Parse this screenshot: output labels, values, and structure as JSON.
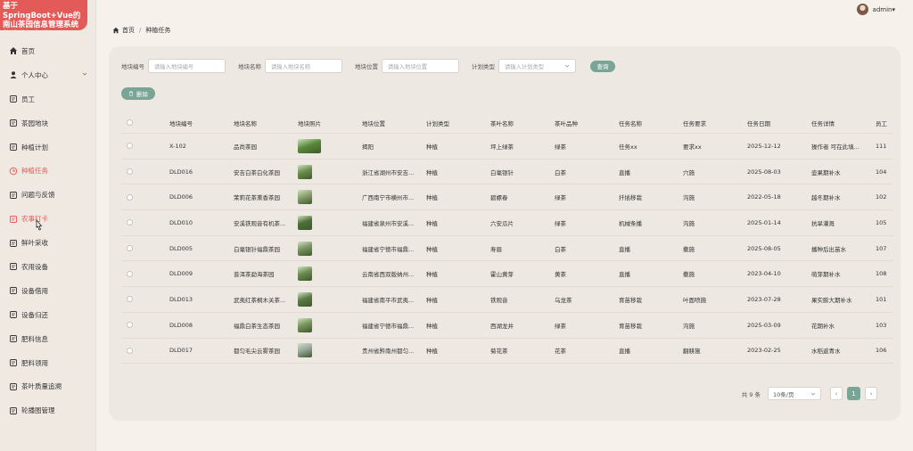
{
  "brand": {
    "title": "基于SpringBoot+Vue的南山茶园信息管理系统的设计与实现"
  },
  "sidebar": {
    "items": [
      {
        "label": "首页",
        "icon": "home-icon"
      },
      {
        "label": "个人中心",
        "icon": "user-icon"
      },
      {
        "label": "员工",
        "icon": "staff-icon"
      },
      {
        "label": "茶园地块",
        "icon": "plot-icon"
      },
      {
        "label": "种植计划",
        "icon": "plan-icon"
      },
      {
        "label": "种植任务",
        "icon": "clock-icon"
      },
      {
        "label": "问题与反馈",
        "icon": "feedback-icon"
      },
      {
        "label": "农事打卡",
        "icon": "checkin-icon"
      },
      {
        "label": "鲜叶采收",
        "icon": "harvest-icon"
      },
      {
        "label": "农用设备",
        "icon": "equipment-icon"
      },
      {
        "label": "设备借用",
        "icon": "borrow-icon"
      },
      {
        "label": "设备归还",
        "icon": "return-icon"
      },
      {
        "label": "肥料信息",
        "icon": "fertilizer-icon"
      },
      {
        "label": "肥料领用",
        "icon": "fertilizer-use-icon"
      },
      {
        "label": "茶叶质量追溯",
        "icon": "quality-icon"
      },
      {
        "label": "轮播图管理",
        "icon": "carousel-icon"
      }
    ]
  },
  "header": {
    "username": "admin",
    "user_caret": "▾"
  },
  "breadcrumb": {
    "home": "首页",
    "separator": "/",
    "current": "种植任务"
  },
  "search": {
    "plot_code_label": "地块编号",
    "plot_code_placeholder": "请输入地块编号",
    "plot_name_label": "地块名称",
    "plot_name_placeholder": "请输入地块名称",
    "plot_location_label": "地块位置",
    "plot_location_placeholder": "请输入地块位置",
    "plan_type_label": "计划类型",
    "plan_type_placeholder": "请输入计划类型",
    "query_button": "查询"
  },
  "toolbar": {
    "delete_button": "删除"
  },
  "table": {
    "columns": [
      "地块编号",
      "地块名称",
      "地块照片",
      "地块位置",
      "计划类型",
      "茶叶名称",
      "茶叶品种",
      "任务名称",
      "任务要求",
      "任务日期",
      "任务详情",
      "员工"
    ],
    "rows": [
      {
        "code": "X-102",
        "name": "品尚茶园",
        "location": "揭阳",
        "plan_type": "种植",
        "tea_name": "坪上绿茶",
        "variety": "绿茶",
        "task": "任务xx",
        "req": "要求xx",
        "date": "2025-12-12",
        "detail": "操作者 可在此填...",
        "staff": "111",
        "thumb_color": "#5a8a3c",
        "thumb_wide": true
      },
      {
        "code": "DLD016",
        "name": "安吉白茶白化茶园",
        "location": "浙江省湖州市安吉...",
        "plan_type": "种植",
        "tea_name": "白毫银针",
        "variety": "白茶",
        "task": "直播",
        "req": "穴施",
        "date": "2025-08-03",
        "detail": "壶果期补水",
        "staff": "104",
        "thumb_color": "#6b8e4e",
        "thumb_wide": false
      },
      {
        "code": "DLD006",
        "name": "茉莉花茶熏香茶园",
        "location": "广西南宁市横州市...",
        "plan_type": "种植",
        "tea_name": "碧螺春",
        "variety": "绿茶",
        "task": "扦插移栽",
        "req": "沟施",
        "date": "2022-05-18",
        "detail": "越冬期补水",
        "staff": "102",
        "thumb_color": "#8aa070",
        "thumb_wide": false
      },
      {
        "code": "DLD010",
        "name": "安溪铁观音有机茶...",
        "location": "福建省泉州市安溪...",
        "plan_type": "种植",
        "tea_name": "六安瓜片",
        "variety": "绿茶",
        "task": "机械条播",
        "req": "沟施",
        "date": "2025-01-14",
        "detail": "抗旱灌溉",
        "staff": "105",
        "thumb_color": "#4f6e3a",
        "thumb_wide": false
      },
      {
        "code": "DLD005",
        "name": "白毫银针福鼎茶园",
        "location": "福建省宁德市福鼎...",
        "plan_type": "种植",
        "tea_name": "寿眉",
        "variety": "白茶",
        "task": "直播",
        "req": "撒施",
        "date": "2025-08-05",
        "detail": "播种后出苗水",
        "staff": "107",
        "thumb_color": "#7c9466",
        "thumb_wide": false
      },
      {
        "code": "DLD009",
        "name": "普洱茶勐海茶园",
        "location": "云南省西双版纳州...",
        "plan_type": "种植",
        "tea_name": "霍山黄芽",
        "variety": "黄茶",
        "task": "直播",
        "req": "撒施",
        "date": "2023-04-10",
        "detail": "萌芽期补水",
        "staff": "108",
        "thumb_color": "#6d8b52",
        "thumb_wide": false
      },
      {
        "code": "DLD013",
        "name": "武夷红茶桐木关茶...",
        "location": "福建省南平市武夷...",
        "plan_type": "种植",
        "tea_name": "铁观音",
        "variety": "乌龙茶",
        "task": "育苗移栽",
        "req": "叶面喷施",
        "date": "2023-07-28",
        "detail": "果实膨大期补水",
        "staff": "101",
        "thumb_color": "#5c7a45",
        "thumb_wide": false
      },
      {
        "code": "DLD008",
        "name": "福鼎白茶生态茶园",
        "location": "福建省宁德市福鼎...",
        "plan_type": "种植",
        "tea_name": "西湖龙井",
        "variety": "绿茶",
        "task": "育苗移栽",
        "req": "沟施",
        "date": "2025-03-09",
        "detail": "花期补水",
        "staff": "103",
        "thumb_color": "#78965c",
        "thumb_wide": false
      },
      {
        "code": "DLD017",
        "name": "都匀毛尖云雾茶园",
        "location": "贵州省黔南州都匀...",
        "plan_type": "种植",
        "tea_name": "菊花茶",
        "variety": "花茶",
        "task": "直播",
        "req": "翻耕施",
        "date": "2023-02-25",
        "detail": "水稻返青水",
        "staff": "106",
        "thumb_color": "#9aa8a0",
        "thumb_wide": false
      }
    ]
  },
  "pager": {
    "total": "共 9 条",
    "page_size": "10条/页",
    "current_page": "1",
    "prev": "‹",
    "next": "›"
  }
}
